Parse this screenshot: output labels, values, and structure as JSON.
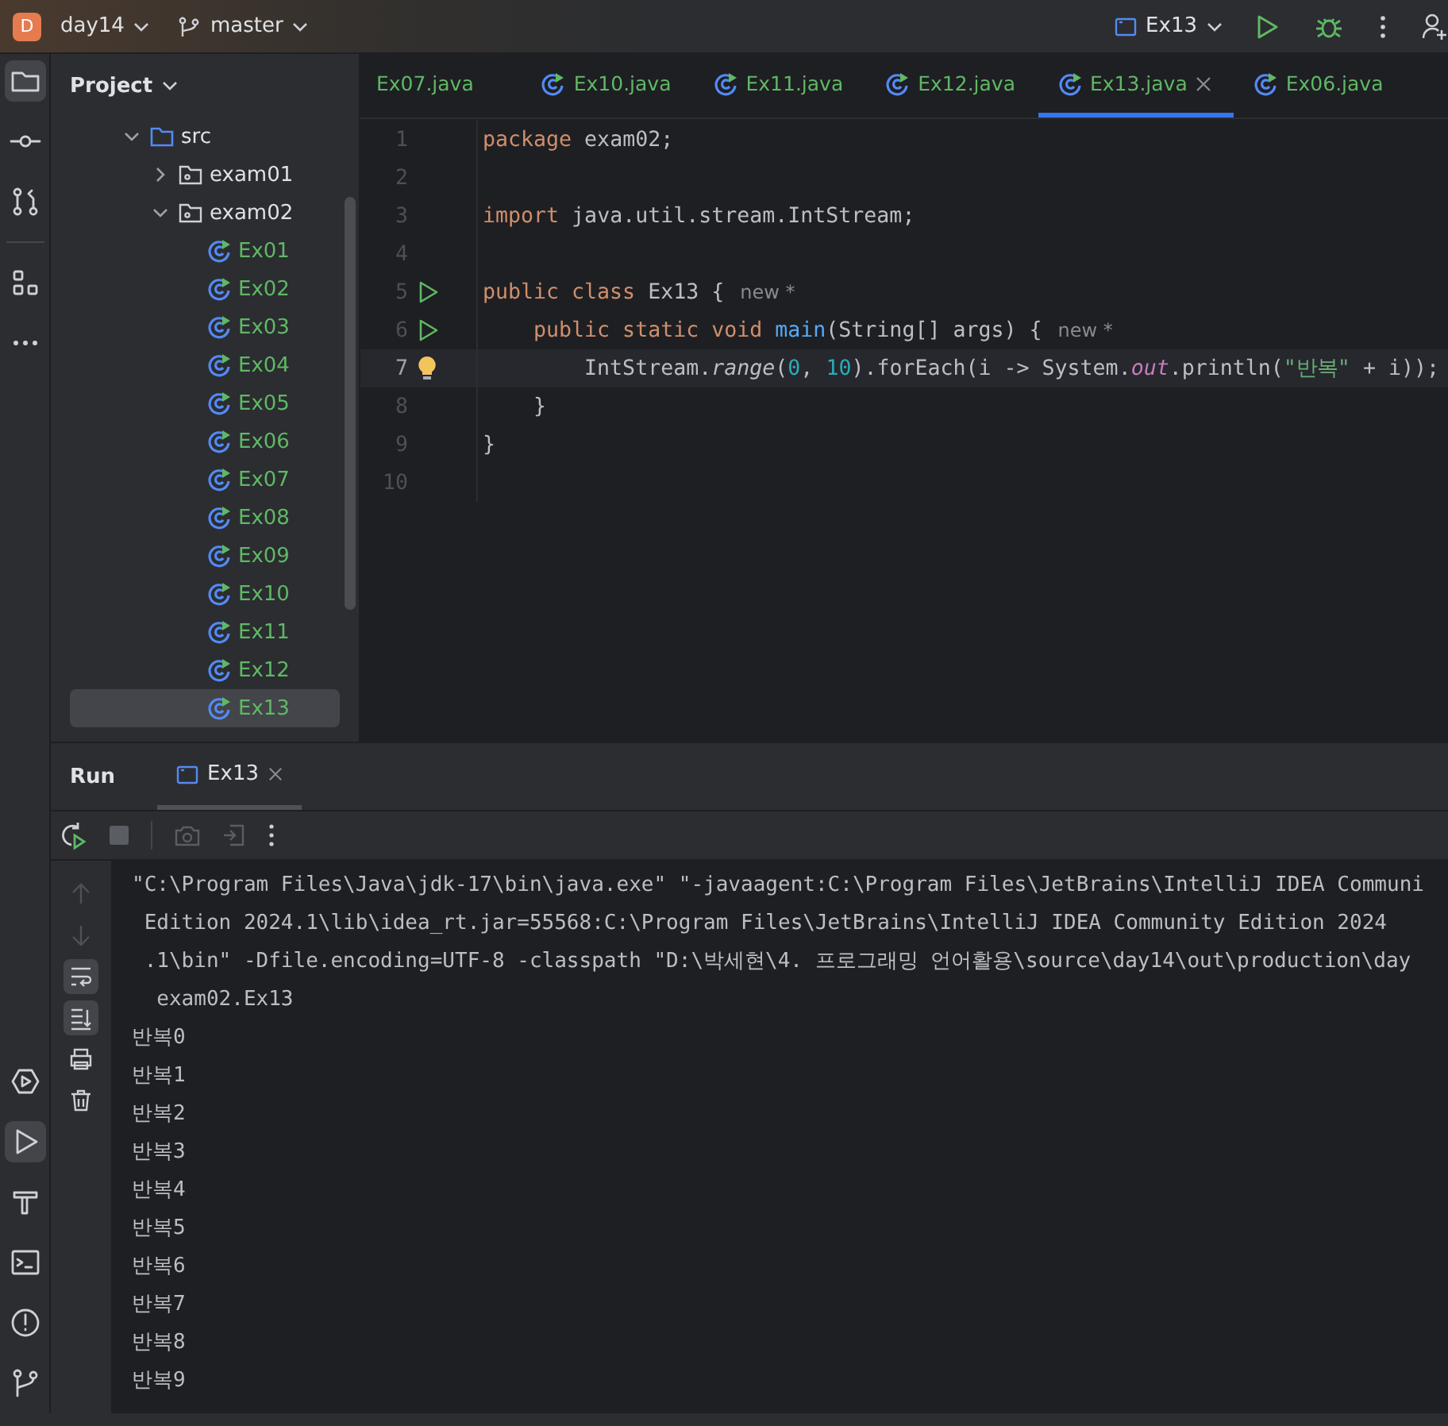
{
  "toolbar": {
    "project_badge": "D",
    "project": "day14",
    "branch": "master",
    "run_config": "Ex13"
  },
  "project_panel": {
    "title": "Project"
  },
  "tree": [
    {
      "label": "src",
      "kind": "source",
      "expanded": true,
      "children": [
        {
          "label": "exam01",
          "kind": "package",
          "expanded": false
        },
        {
          "label": "exam02",
          "kind": "package",
          "expanded": true,
          "children": [
            {
              "label": "Ex01",
              "kind": "class",
              "selected": false
            },
            {
              "label": "Ex02",
              "kind": "class",
              "selected": false
            },
            {
              "label": "Ex03",
              "kind": "class",
              "selected": false
            },
            {
              "label": "Ex04",
              "kind": "class",
              "selected": false
            },
            {
              "label": "Ex05",
              "kind": "class",
              "selected": false
            },
            {
              "label": "Ex06",
              "kind": "class",
              "selected": false
            },
            {
              "label": "Ex07",
              "kind": "class",
              "selected": false
            },
            {
              "label": "Ex08",
              "kind": "class",
              "selected": false
            },
            {
              "label": "Ex09",
              "kind": "class",
              "selected": false
            },
            {
              "label": "Ex10",
              "kind": "class",
              "selected": false
            },
            {
              "label": "Ex11",
              "kind": "class",
              "selected": false
            },
            {
              "label": "Ex12",
              "kind": "class",
              "selected": false
            },
            {
              "label": "Ex13",
              "kind": "class",
              "selected": true
            }
          ]
        }
      ]
    }
  ],
  "editor_tabs": [
    {
      "label": "Ex07.java",
      "selected": false,
      "icon_visible": false
    },
    {
      "label": "Ex10.java",
      "selected": false,
      "icon_visible": true
    },
    {
      "label": "Ex11.java",
      "selected": false,
      "icon_visible": true
    },
    {
      "label": "Ex12.java",
      "selected": false,
      "icon_visible": true
    },
    {
      "label": "Ex13.java",
      "selected": true,
      "icon_visible": true
    },
    {
      "label": "Ex06.java",
      "selected": false,
      "icon_visible": true
    }
  ],
  "code_lines": [
    {
      "number": "1",
      "current": false,
      "tokens": [
        {
          "text": "package",
          "kind": "keyword"
        },
        {
          "text": " exam02;",
          "kind": "plain"
        }
      ]
    },
    {
      "number": "2",
      "current": false
    },
    {
      "number": "3",
      "current": false,
      "tokens": [
        {
          "text": "import",
          "kind": "keyword"
        },
        {
          "text": " java.util.stream.IntStream;",
          "kind": "plain"
        }
      ]
    },
    {
      "number": "4",
      "current": false
    },
    {
      "number": "5",
      "current": false,
      "gutter": {
        "kind": "run"
      },
      "hint": "new *",
      "tokens": [
        {
          "text": "public class",
          "kind": "keyword"
        },
        {
          "text": " Ex13 {",
          "kind": "plain"
        }
      ]
    },
    {
      "number": "6",
      "current": false,
      "gutter": {
        "kind": "run"
      },
      "hint": "new *",
      "tokens": [
        {
          "text": "    public static void ",
          "kind": "keyword"
        },
        {
          "text": "main",
          "kind": "method"
        },
        {
          "text": "(String[] args) {",
          "kind": "plain"
        }
      ]
    },
    {
      "number": "7",
      "current": true,
      "gutter": {
        "kind": "bulb"
      },
      "tokens": [
        {
          "text": "        IntStream.",
          "kind": "plain"
        },
        {
          "text": "range",
          "kind": "static"
        },
        {
          "text": "(",
          "kind": "plain"
        },
        {
          "text": "0",
          "kind": "number"
        },
        {
          "text": ", ",
          "kind": "plain"
        },
        {
          "text": "10",
          "kind": "number"
        },
        {
          "text": ").forEach(i -> System.",
          "kind": "plain"
        },
        {
          "text": "out",
          "kind": "field"
        },
        {
          "text": ".println(",
          "kind": "plain"
        },
        {
          "text": "\"반복\"",
          "kind": "string"
        },
        {
          "text": " + i));",
          "kind": "plain"
        }
      ]
    },
    {
      "number": "8",
      "current": false,
      "tokens": [
        {
          "text": "    }",
          "kind": "plain"
        }
      ]
    },
    {
      "number": "9",
      "current": false,
      "tokens": [
        {
          "text": "}",
          "kind": "plain"
        }
      ]
    },
    {
      "number": "10",
      "current": false
    }
  ],
  "run_panel": {
    "title": "Run",
    "tabs": [
      {
        "label": "Ex13",
        "selected": true
      }
    ],
    "console_lines": [
      "\"C:\\Program Files\\Java\\jdk-17\\bin\\java.exe\" \"-javaagent:C:\\Program Files\\JetBrains\\IntelliJ IDEA Communi",
      " Edition 2024.1\\lib\\idea_rt.jar=55568:C:\\Program Files\\JetBrains\\IntelliJ IDEA Community Edition 2024",
      " .1\\bin\" -Dfile.encoding=UTF-8 -classpath \"D:\\박세현\\4. 프로그래밍 언어활용\\source\\day14\\out\\production\\day",
      "  exam02.Ex13",
      "반복0",
      "반복1",
      "반복2",
      "반복3",
      "반복4",
      "반복5",
      "반복6",
      "반복7",
      "반복8",
      "반복9"
    ]
  },
  "tool_strip": {
    "top": [
      {
        "kind": "folder",
        "selected": true
      },
      {
        "kind": "commit",
        "selected": false
      },
      {
        "kind": "pull",
        "selected": false
      },
      {
        "kind": "structure",
        "selected": false
      },
      {
        "kind": "more",
        "selected": false
      }
    ],
    "bottom": [
      {
        "kind": "services",
        "selected": false
      },
      {
        "kind": "run",
        "selected": true
      },
      {
        "kind": "build",
        "selected": false
      },
      {
        "kind": "terminal",
        "selected": false
      },
      {
        "kind": "problems",
        "selected": false
      },
      {
        "kind": "git",
        "selected": false
      }
    ]
  },
  "console_tools": [
    {
      "kind": "up",
      "disabled": true
    },
    {
      "kind": "down",
      "disabled": true
    },
    {
      "kind": "wrap",
      "on": true
    },
    {
      "kind": "scroll-end",
      "on": true
    },
    {
      "kind": "print"
    },
    {
      "kind": "trash"
    }
  ]
}
